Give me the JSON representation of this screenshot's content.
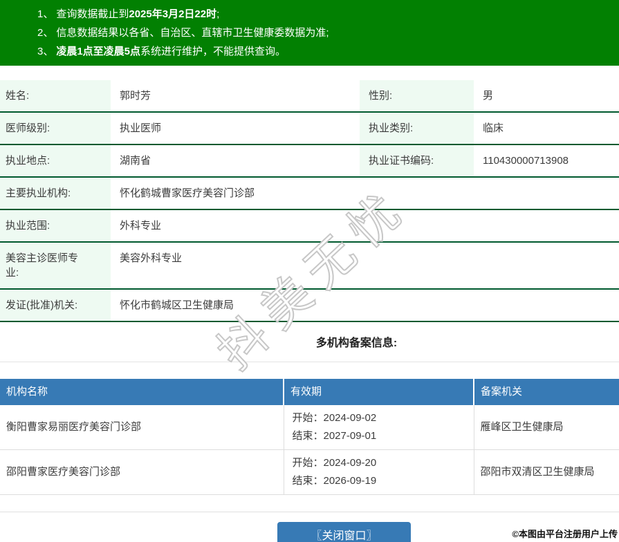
{
  "banner": {
    "lines": [
      {
        "num": "1、",
        "pre": "查询数据截止到",
        "bold": "2025年3月2日22时",
        "post": ";"
      },
      {
        "num": "2、",
        "pre": "信息数据结果以各省、自治区、直辖市卫生健康委数据为准;",
        "bold": "",
        "post": ""
      },
      {
        "num": "3、",
        "pre": "",
        "bold": "凌晨1点至凌晨5点",
        "post": "系统进行维护，不能提供查询。"
      }
    ]
  },
  "doctor": {
    "rows": [
      {
        "label": "姓名:",
        "value": "郭时芳",
        "label2": "性别:",
        "value2": "男"
      },
      {
        "label": "医师级别:",
        "value": "执业医师",
        "label2": "执业类别:",
        "value2": "临床"
      },
      {
        "label": "执业地点:",
        "value": "湖南省",
        "label2": "执业证书编码:",
        "value2": "110430000713908"
      },
      {
        "label": "主要执业机构:",
        "value": "怀化鹤城曹家医疗美容门诊部"
      },
      {
        "label": "执业范围:",
        "value": "外科专业"
      },
      {
        "label": "美容主诊医师专业:",
        "value": "美容外科专业"
      },
      {
        "label": "发证(批准)机关:",
        "value": "怀化市鹤城区卫生健康局"
      }
    ]
  },
  "section": {
    "title": "多机构备案信息:"
  },
  "filing": {
    "headers": [
      "机构名称",
      "有效期",
      "备案机关"
    ],
    "rows": [
      {
        "org": "衡阳曹家易丽医疗美容门诊部",
        "start": "开始：2024-09-02",
        "end": "结束：2027-09-01",
        "authority": "雁峰区卫生健康局"
      },
      {
        "org": "邵阳曹家医疗美容门诊部",
        "start": "开始：2024-09-20",
        "end": "结束：2026-09-19",
        "authority": "邵阳市双清区卫生健康局"
      }
    ]
  },
  "footer": {
    "close_button": "〖关闭窗口〗",
    "copyright": "©本图由平台注册用户上传"
  },
  "watermark": {
    "text": "抖美无忧"
  },
  "colors": {
    "banner_green": "#028002",
    "row_border_green": "#00592e",
    "label_bg_mint": "#eefaf2",
    "header_blue": "#377ab5",
    "button_blue": "#377ab5"
  }
}
